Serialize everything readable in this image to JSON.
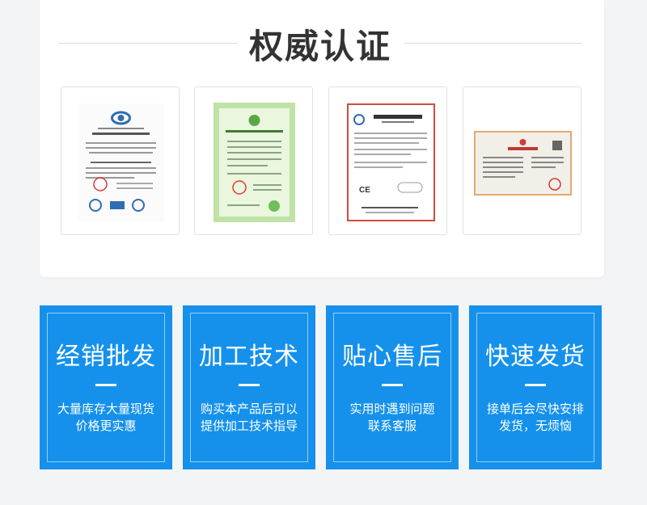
{
  "section": {
    "title": "权威认证"
  },
  "certificates": [
    {
      "icon": "quality-management-certificate-image",
      "colors": {
        "border": "#ffffff",
        "emblem": "#2f6db5",
        "seal": "#d23a3a"
      }
    },
    {
      "icon": "environmental-label-certificate-image",
      "colors": {
        "border": "#9fd28b",
        "emblem": "#e23a2e"
      }
    },
    {
      "icon": "ce-conformity-certificate-image",
      "colors": {
        "border": "#d24b3c"
      }
    },
    {
      "icon": "business-license-image",
      "colors": {
        "border": "#e3a86f",
        "seal": "#d23a3a"
      }
    }
  ],
  "features": [
    {
      "title": "经销批发",
      "desc": "大量库存大量现货\n价格更实惠"
    },
    {
      "title": "加工技术",
      "desc": "购买本产品后可以\n提供加工技术指导"
    },
    {
      "title": "贴心售后",
      "desc": "实用时遇到问题\n联系客服"
    },
    {
      "title": "快速发货",
      "desc": "接单后会尽快安排\n发货，无烦恼"
    }
  ],
  "colors": {
    "accent": "#1591ec",
    "background": "#f3f4f6",
    "title": "#333333"
  }
}
